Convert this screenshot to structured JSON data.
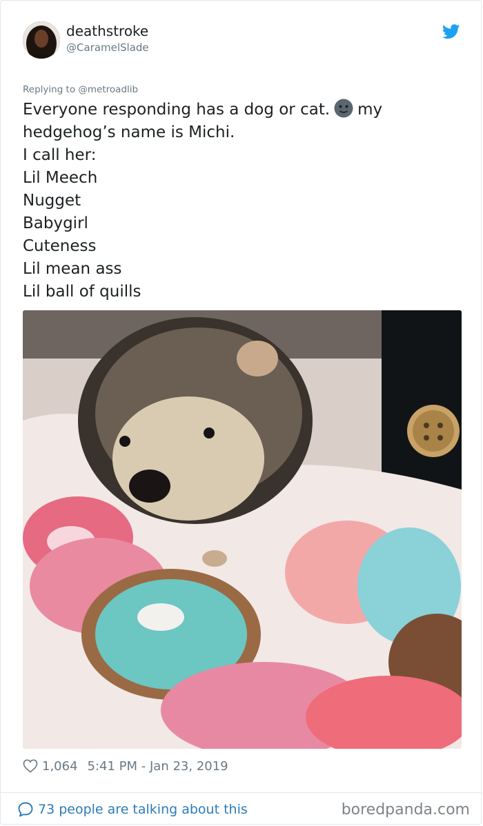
{
  "tweet": {
    "author": {
      "display_name": "deathstroke",
      "handle": "@CaramelSlade"
    },
    "reply_prefix": "Replying to ",
    "reply_to": "@metroadlib",
    "text_before_emoji": "Everyone responding has a dog or cat.",
    "emoji": "neutral-face-emoji",
    "text_after_emoji": "my\nhedgehog’s name is Michi.\nI call her:\nLil Meech\nNugget\nBabygirl\nCuteness\nLil mean ass\nLil ball of quills",
    "photo": "hedgehog-on-donut-print-blanket",
    "likes": "1,064",
    "timestamp": "5:41 PM - Jan 23, 2019",
    "talking_label": "73 people are talking about this"
  },
  "watermark": "boredpanda.com",
  "colors": {
    "link_blue": "#2b7bb9",
    "twitter_blue": "#1da1f2",
    "muted_gray": "#697882",
    "text_dark": "#1c2022"
  },
  "icons": {
    "brand": "twitter-bird-icon",
    "like": "heart-outline-icon",
    "talk": "speech-bubble-icon"
  }
}
